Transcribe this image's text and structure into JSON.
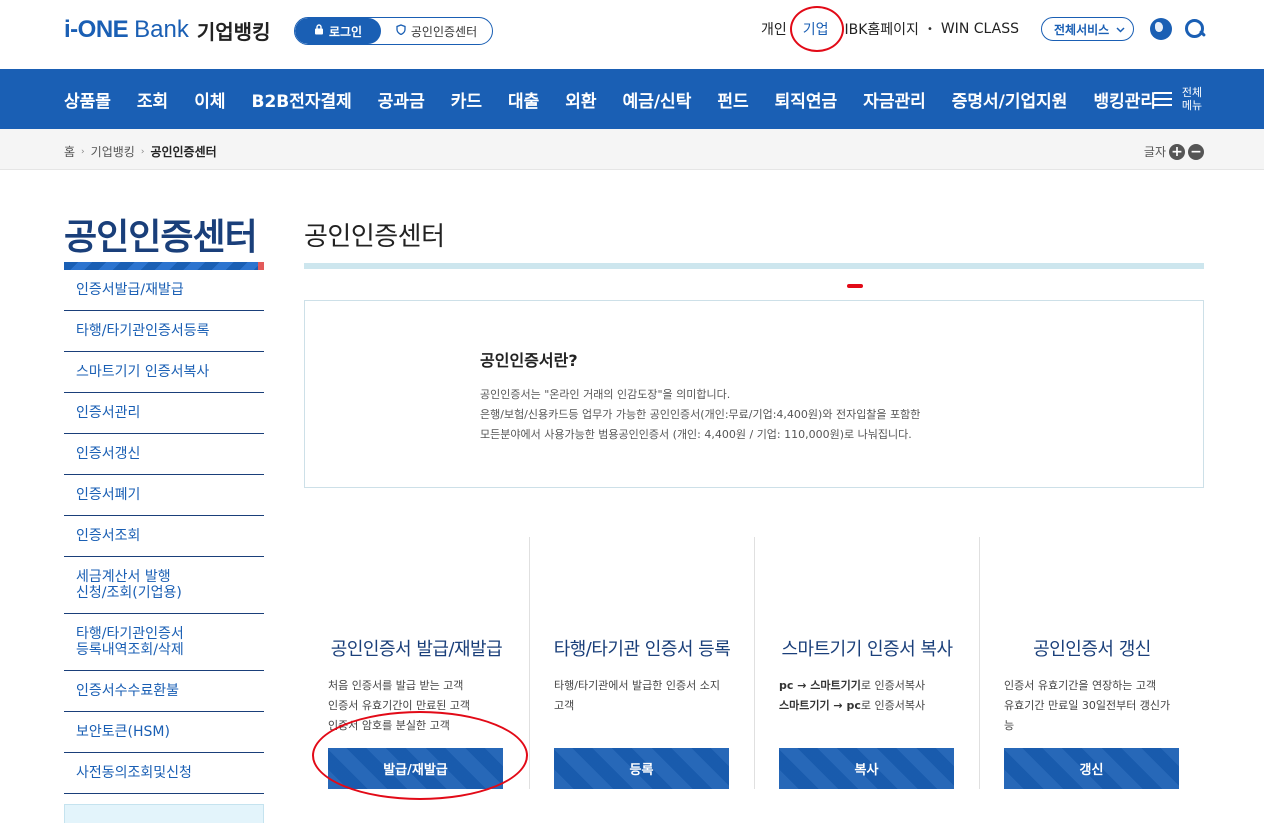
{
  "header": {
    "logo_ione": "i-ONE",
    "logo_bank": "Bank",
    "logo_kr": "기업뱅킹",
    "login_label": "로그인",
    "cert_center_label": "공인인증센터",
    "links": [
      {
        "label": "개인",
        "active": false
      },
      {
        "label": "기업",
        "active": true
      },
      {
        "label": "IBK홈페이지",
        "active": false
      },
      {
        "label": "WIN CLASS",
        "active": false
      }
    ],
    "dot": "•",
    "all_services": "전체서비스",
    "icons": [
      "lock-icon",
      "shield-icon",
      "chevron-down-icon",
      "globe-icon",
      "search-icon"
    ]
  },
  "gnb": {
    "items": [
      "상품몰",
      "조회",
      "이체",
      "B2B전자결제",
      "공과금",
      "카드",
      "대출",
      "외환",
      "예금/신탁",
      "펀드",
      "퇴직연금",
      "자금관리",
      "증명서/기업지원",
      "뱅킹관리"
    ],
    "all_menu_line1": "전체",
    "all_menu_line2": "메뉴"
  },
  "breadcrumb": {
    "items": [
      "홈",
      "기업뱅킹",
      "공인인증센터"
    ],
    "sep": "›",
    "font_label": "글자",
    "plus": "+",
    "minus": "−"
  },
  "sidebar": {
    "title": "공인인증센터",
    "items": [
      {
        "label": "인증서발급/재발급",
        "lines": 1
      },
      {
        "label": "타행/타기관인증서등록",
        "lines": 1
      },
      {
        "label": "스마트기기 인증서복사",
        "lines": 1
      },
      {
        "label": "인증서관리",
        "lines": 1
      },
      {
        "label": "인증서갱신",
        "lines": 1
      },
      {
        "label": "인증서폐기",
        "lines": 1
      },
      {
        "label": "인증서조회",
        "lines": 1
      },
      {
        "label_line1": "세금계산서 발행",
        "label_line2": "신청/조회(기업용)",
        "lines": 2
      },
      {
        "label_line1": "타행/타기관인증서",
        "label_line2": "등록내역조회/삭제",
        "lines": 2
      },
      {
        "label": "인증서수수료환불",
        "lines": 1
      },
      {
        "label": "보안토큰(HSM)",
        "lines": 1
      },
      {
        "label": "사전동의조회및신청",
        "lines": 1
      }
    ]
  },
  "main": {
    "page_title": "공인인증센터",
    "info_title": "공인인증서란?",
    "info_lines": [
      "공인인증서는 \"온라인 거래의 인감도장\"을 의미합니다.",
      "은행/보험/신용카드등 업무가 가능한 공인인증서(개인:무료/기업:4,400원)와 전자입찰을 포함한",
      "모든분야에서 사용가능한 범용공인인증서 (개인: 4,400원 / 기업: 110,000원)로 나눠집니다."
    ],
    "cards": [
      {
        "title": "공인인증서 발급/재발급",
        "desc": [
          "처음 인증서를 발급 받는 고객",
          "인증서 유효기간이 만료된 고객",
          "인증서 암호를 분실한 고객"
        ],
        "button": "발급/재발급"
      },
      {
        "title": "타행/타기관 인증서 등록",
        "desc": [
          "타행/타기관에서 발급한 인증서 소지",
          "고객"
        ],
        "button": "등록"
      },
      {
        "title": "스마트기기 인증서 복사",
        "desc_rich": [
          {
            "a": "pc → 스마트기기",
            "b": "로 인증서복사"
          },
          {
            "a": "스마트기기 → pc",
            "b": "로 인증서복사"
          }
        ],
        "button": "복사"
      },
      {
        "title": "공인인증서 갱신",
        "desc": [
          "인증서 유효기간을 연장하는 고객",
          "유효기간 만료일 30일전부터 갱신가",
          "능"
        ],
        "button": "갱신"
      }
    ]
  },
  "colors": {
    "primary": "#1a5fb4",
    "dark_navy": "#1a3f7a",
    "annotation_red": "#e20a17",
    "light_line": "#cde6ee"
  }
}
